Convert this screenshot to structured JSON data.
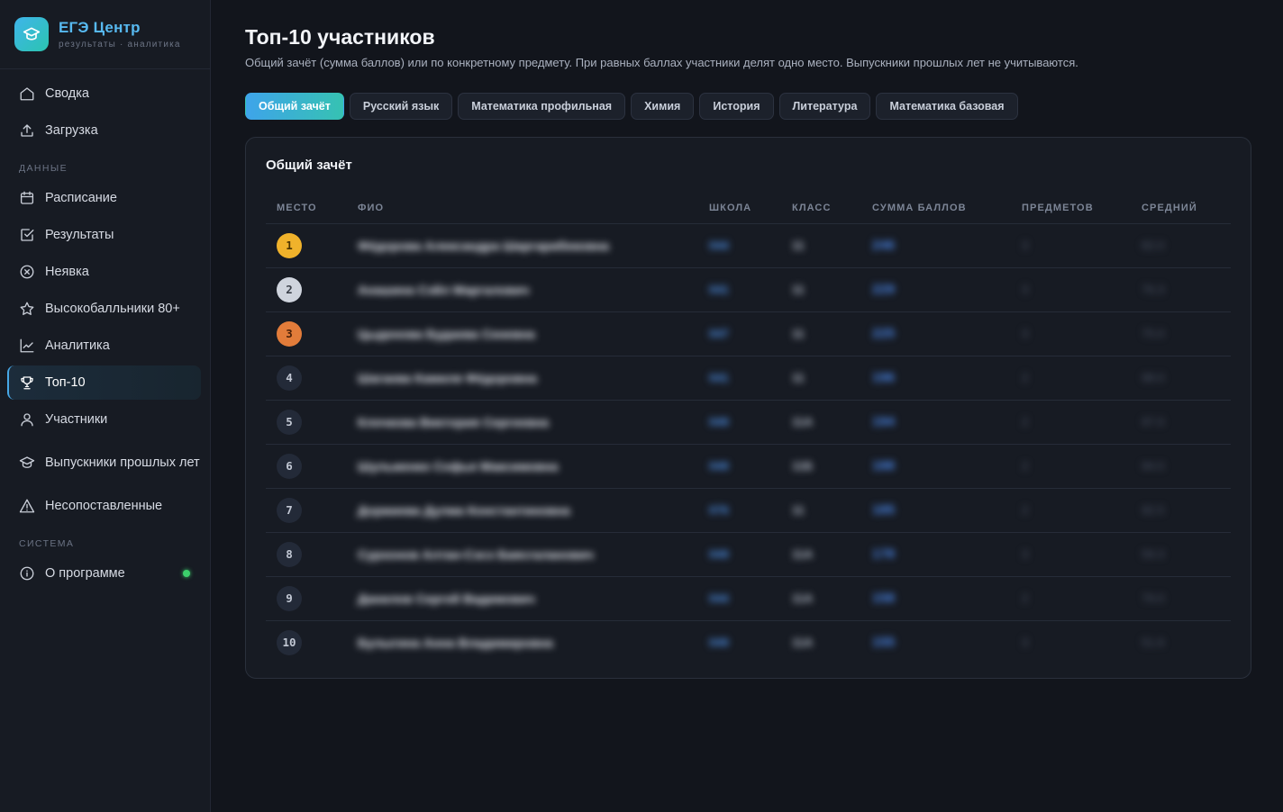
{
  "brand": {
    "title": "ЕГЭ Центр",
    "subtitle": "результаты · аналитика"
  },
  "sidebar": {
    "top_items": [
      {
        "label": "Сводка",
        "icon": "home-icon"
      },
      {
        "label": "Загрузка",
        "icon": "upload-icon"
      }
    ],
    "section_data": "ДАННЫЕ",
    "data_items": [
      {
        "label": "Расписание",
        "icon": "calendar-icon"
      },
      {
        "label": "Результаты",
        "icon": "checkbox-icon"
      },
      {
        "label": "Неявка",
        "icon": "x-circle-icon"
      },
      {
        "label": "Высокобалльники 80+",
        "icon": "star-icon"
      },
      {
        "label": "Аналитика",
        "icon": "chart-line-icon"
      },
      {
        "label": "Топ-10",
        "icon": "trophy-icon",
        "active": true
      },
      {
        "label": "Участники",
        "icon": "user-icon"
      },
      {
        "label": "Выпускники прошлых лет",
        "icon": "graduation-cap-icon"
      },
      {
        "label": "Несопоставленные",
        "icon": "warning-icon"
      }
    ],
    "section_system": "СИСТЕМА",
    "system_items": [
      {
        "label": "О программе",
        "icon": "info-icon",
        "status_color": "#3ccf6b"
      }
    ]
  },
  "header": {
    "title": "Топ-10 участников",
    "description": "Общий зачёт (сумма баллов) или по конкретному предмету. При равных баллах участники делят одно место. Выпускники прошлых лет не учитываются."
  },
  "tabs": [
    {
      "label": "Общий зачёт",
      "active": true
    },
    {
      "label": "Русский язык"
    },
    {
      "label": "Математика профильная"
    },
    {
      "label": "Химия"
    },
    {
      "label": "История"
    },
    {
      "label": "Литература"
    },
    {
      "label": "Математика базовая"
    }
  ],
  "panel": {
    "title": "Общий зачёт",
    "columns": {
      "place": "МЕСТО",
      "fio": "ФИО",
      "school": "ШКОЛА",
      "class": "КЛАСС",
      "sum": "СУММА БАЛЛОВ",
      "subjects": "ПРЕДМЕТОВ",
      "average": "СРЕДНИЙ"
    },
    "rows": [
      {
        "place": "1",
        "medal": "gold",
        "fio": "Фёдорова Александра Шаргарибековна",
        "school": "044",
        "class": "11",
        "sum": "246",
        "subjects": "3",
        "average": "82.0"
      },
      {
        "place": "2",
        "medal": "silver",
        "fio": "Анашина Сэйл Маргалович",
        "school": "041",
        "class": "11",
        "sum": "229",
        "subjects": "3",
        "average": "76.3"
      },
      {
        "place": "3",
        "medal": "bronze",
        "fio": "Цыденова Будаева Сеневна",
        "school": "047",
        "class": "11",
        "sum": "225",
        "subjects": "3",
        "average": "75.0"
      },
      {
        "place": "4",
        "medal": "",
        "fio": "Шагаева Камиля Фёдоровна",
        "school": "041",
        "class": "11",
        "sum": "196",
        "subjects": "2",
        "average": "98.0"
      },
      {
        "place": "5",
        "medal": "",
        "fio": "Клочкова Виктория Сергеевна",
        "school": "049",
        "class": "11А",
        "sum": "194",
        "subjects": "2",
        "average": "97.0"
      },
      {
        "place": "6",
        "medal": "",
        "fio": "Шульженко Софья Максимовна",
        "school": "049",
        "class": "11Б",
        "sum": "188",
        "subjects": "2",
        "average": "94.0"
      },
      {
        "place": "7",
        "medal": "",
        "fio": "Доржиева Дулма Константиновна",
        "school": "076",
        "class": "11",
        "sum": "185",
        "subjects": "2",
        "average": "92.5"
      },
      {
        "place": "8",
        "medal": "",
        "fio": "Сурхонов Алтан-Сэсэ Баясгаланович",
        "school": "049",
        "class": "11А",
        "sum": "178",
        "subjects": "3",
        "average": "59.3"
      },
      {
        "place": "9",
        "medal": "",
        "fio": "Данилов Сергей Вадимович",
        "school": "044",
        "class": "11А",
        "sum": "158",
        "subjects": "2",
        "average": "79.0"
      },
      {
        "place": "10",
        "medal": "",
        "fio": "Булыгина Анна Владимировна",
        "school": "049",
        "class": "11А",
        "sum": "155",
        "subjects": "3",
        "average": "51.6"
      }
    ]
  }
}
